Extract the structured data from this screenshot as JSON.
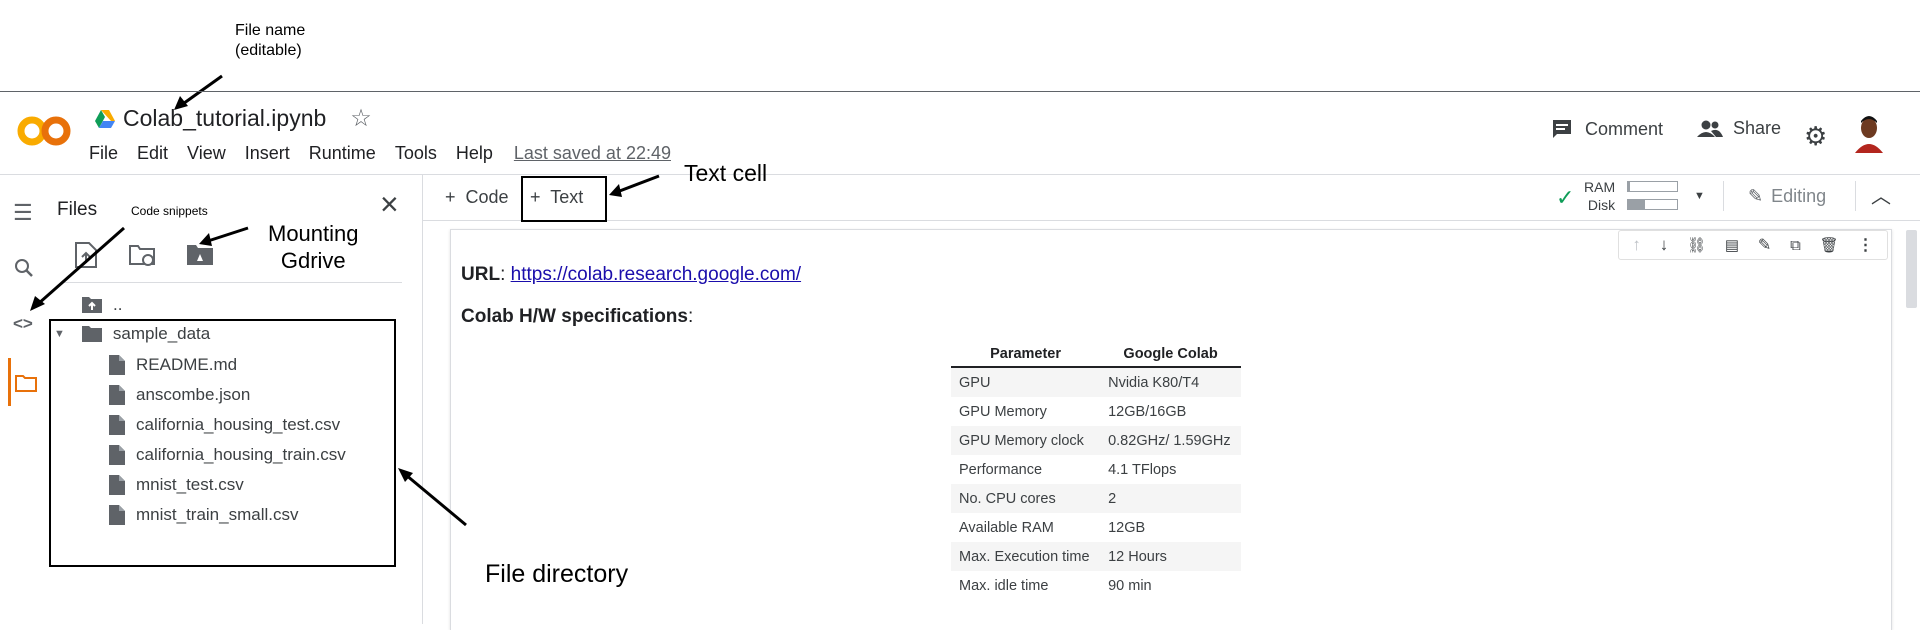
{
  "annotations": {
    "file_name": "File name\n(editable)",
    "text_cell": "Text cell",
    "code_snippets": "Code snippets",
    "mounting_gdrive": "Mounting\nGdrive",
    "file_directory": "File directory"
  },
  "header": {
    "logo": "CO",
    "filename": "Colab_tutorial.ipynb",
    "menu": [
      "File",
      "Edit",
      "View",
      "Insert",
      "Runtime",
      "Tools",
      "Help"
    ],
    "last_saved": "Last saved at 22:49",
    "comment_label": "Comment",
    "share_label": "Share"
  },
  "sidebar": {
    "title": "Files",
    "parent_dir": "..",
    "folder": "sample_data",
    "files": [
      "README.md",
      "anscombe.json",
      "california_housing_test.csv",
      "california_housing_train.csv",
      "mnist_test.csv",
      "mnist_train_small.csv"
    ]
  },
  "toolbar": {
    "code_label": "Code",
    "text_label": "Text",
    "ram_label": "RAM",
    "disk_label": "Disk",
    "editing_label": "Editing"
  },
  "resources": {
    "ram_fraction": 0.04,
    "disk_fraction": 0.35
  },
  "cell": {
    "url_label": "URL",
    "url": "https://colab.research.google.com/",
    "specs_heading": "Colab H/W specifications",
    "table": {
      "headers": [
        "Parameter",
        "Google Colab"
      ],
      "rows": [
        [
          "GPU",
          "Nvidia K80/T4"
        ],
        [
          "GPU Memory",
          "12GB/16GB"
        ],
        [
          "GPU Memory clock",
          "0.82GHz/ 1.59GHz"
        ],
        [
          "Performance",
          "4.1 TFlops"
        ],
        [
          "No. CPU cores",
          "2"
        ],
        [
          "Available RAM",
          "12GB"
        ],
        [
          "Max. Execution time",
          "12 Hours"
        ],
        [
          "Max. idle time",
          "90 min"
        ]
      ]
    }
  },
  "colors": {
    "accent_orange": "#e8710a",
    "logo_yellow": "#f9ab00",
    "link_blue": "#1a0dab",
    "check_green": "#0f9d58"
  }
}
